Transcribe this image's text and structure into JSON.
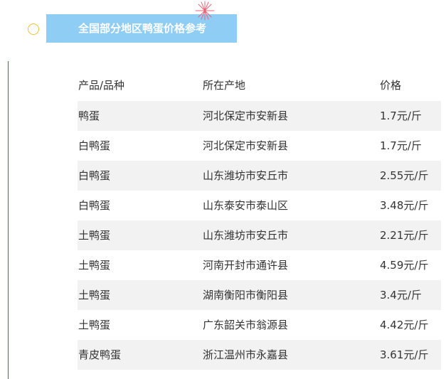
{
  "title": "全国部分地区鸭蛋价格参考",
  "colors": {
    "banner": "#8fcdf4",
    "shade": "#f2f2f2",
    "accent_line": "#c0392b",
    "circle": "#f2c230"
  },
  "table": {
    "headers": [
      "产品/品种",
      "所在产地",
      "价格"
    ],
    "rows": [
      [
        "鸭蛋",
        "河北保定市安新县",
        "1.7元/斤"
      ],
      [
        "白鸭蛋",
        "河北保定市安新县",
        "1.7元/斤"
      ],
      [
        "白鸭蛋",
        "山东潍坊市安丘市",
        "2.55元/斤"
      ],
      [
        "白鸭蛋",
        "山东泰安市泰山区",
        "3.48元/斤"
      ],
      [
        "土鸭蛋",
        "山东潍坊市安丘市",
        "2.21元/斤"
      ],
      [
        "土鸭蛋",
        "河南开封市通许县",
        "4.59元/斤"
      ],
      [
        "土鸭蛋",
        "湖南衡阳市衡阳县",
        "3.4元/斤"
      ],
      [
        "土鸭蛋",
        "广东韶关市翁源县",
        "4.42元/斤"
      ],
      [
        "青皮鸭蛋",
        "浙江温州市永嘉县",
        "3.61元/斤"
      ]
    ]
  }
}
